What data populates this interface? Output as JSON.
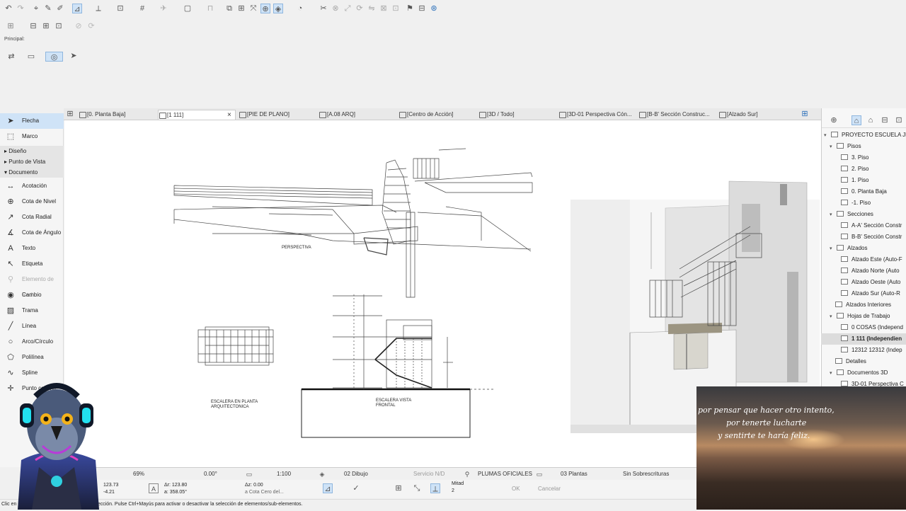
{
  "toolbar": {
    "principal_label": "Principal:"
  },
  "tabs": [
    {
      "label": "[0. Planta Baja]"
    },
    {
      "label": "[1 111]"
    },
    {
      "label": "[PIE DE PLANO]"
    },
    {
      "label": "[A.08 ARQ]"
    },
    {
      "label": "[Centro de Acción]"
    },
    {
      "label": "[3D / Todo]"
    },
    {
      "label": "[3D-01 Perspectiva Cón..."
    },
    {
      "label": "[B-B' Sección Construc..."
    },
    {
      "label": "[Alzado Sur]"
    }
  ],
  "tab_close": "×",
  "toolbox": {
    "flecha": "Flecha",
    "marco": "Marco",
    "groups": {
      "diseno": "Diseño",
      "punto_de_vista": "Punto de Vista",
      "documento": "Documento"
    },
    "items": [
      {
        "label": "Acotación",
        "icon": "dimension-icon"
      },
      {
        "label": "Cota de Nivel",
        "icon": "level-dimension-icon"
      },
      {
        "label": "Cota Radial",
        "icon": "radial-dimension-icon"
      },
      {
        "label": "Cota de Ángulo",
        "icon": "angle-dimension-icon"
      },
      {
        "label": "Texto",
        "icon": "text-icon"
      },
      {
        "label": "Etiqueta",
        "icon": "label-icon"
      },
      {
        "label": "Elemento de Red",
        "icon": "grid-element-icon"
      },
      {
        "label": "Cambio",
        "icon": "change-icon"
      },
      {
        "label": "Trama",
        "icon": "fill-icon"
      },
      {
        "label": "Línea",
        "icon": "line-icon"
      },
      {
        "label": "Arco/Círculo",
        "icon": "arc-icon"
      },
      {
        "label": "Polilínea",
        "icon": "polyline-icon"
      },
      {
        "label": "Spline",
        "icon": "spline-icon"
      },
      {
        "label": "Punto caliente",
        "icon": "hotspot-icon"
      }
    ]
  },
  "navigator": {
    "project": "PROYECTO ESCUELA JHO",
    "pisos": "Pisos",
    "piso_items": [
      "3. Piso",
      "2. Piso",
      "1. Piso",
      "0. Planta Baja",
      "-1. Piso"
    ],
    "secciones": "Secciones",
    "seccion_items": [
      "A-A' Sección Constr",
      "B-B' Sección Constr"
    ],
    "alzados": "Alzados",
    "alzado_items": [
      "Alzado Este (Auto-F",
      "Alzado Norte (Auto",
      "Alzado Oeste (Auto",
      "Alzado Sur (Auto-R"
    ],
    "alzados_interiores": "Alzados Interiores",
    "hojas": "Hojas de Trabajo",
    "hoja_items": [
      "0 COSAS (Independ",
      "1 111 (Independien",
      "12312 12312 (Indep"
    ],
    "detalles": "Detalles",
    "documentos3d": "Documentos 3D",
    "doc3d_items": [
      "3D-01 Perspectiva C"
    ]
  },
  "drawing": {
    "perspectiva": "PERSPECTIVA",
    "planta_1": "ESCALERA EN PLANTA",
    "planta_2": "ARQUITECTONICA",
    "frontal_1": "ESCALERA VISTA",
    "frontal_2": "FRONTAL"
  },
  "status": {
    "zoom": "69%",
    "angle": "0.00°",
    "scale": "1:100",
    "layer": "02 Dibujo",
    "servicio": "Servicio N/D",
    "plumas": "PLUMAS OFICIALES",
    "plantas": "03 Plantas",
    "sobre": "Sin Sobrescrituras",
    "x": "123.73",
    "y": "-4.21",
    "dr": "Δr: 123.80",
    "ang": "a: 358.05°",
    "dz": "Δz: 0.00",
    "cota": "a Cota Cero del...",
    "mitad": "Mitad",
    "mitad_n": "2",
    "ok": "OK",
    "cancel": "Cancelar",
    "hint": "Clic en un elemento o dibuje un área de Selección. Pulse Ctrl+Mayús para activar o desactivar la selección de elementos/sub-elementos."
  },
  "video_overlay": {
    "line1": "por pensar que hacer otro intento,",
    "line2": "por tenerte lucharte",
    "line3": "y sentirte te haría feliz."
  }
}
